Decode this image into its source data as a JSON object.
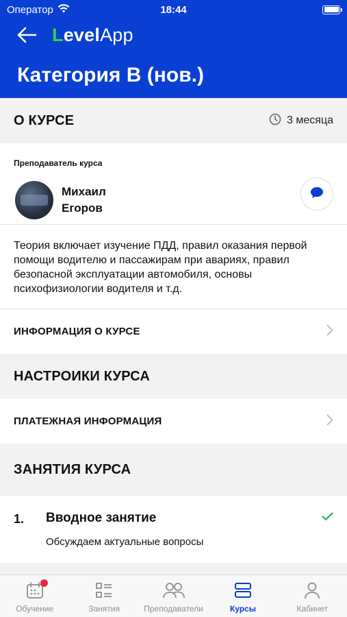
{
  "status": {
    "carrier": "Оператор",
    "time": "18:44"
  },
  "header": {
    "logo_l": "L",
    "logo_evel": "evel",
    "logo_app": "App",
    "title": "Категория В (нов.)"
  },
  "about": {
    "heading": "О КУРСЕ",
    "duration": "3 месяца",
    "teacher_label": "Преподаватель курса",
    "teacher_first": "Михаил",
    "teacher_last": "Егоров",
    "description": "Теория включает изучение ПДД, правил оказания первой помощи водителю и пассажирам при авариях, правил безопасной эксплуатации автомобиля, основы психофизиологии водителя и т.д.",
    "info_link": "ИНФОРМАЦИЯ О КУРСЕ"
  },
  "settings": {
    "heading": "НАСТРОИКИ КУРСА",
    "payment_link": "ПЛАТЕЖНАЯ ИНФОРМАЦИЯ"
  },
  "lessons": {
    "heading": "ЗАНЯТИЯ КУРСА",
    "items": [
      {
        "num": "1.",
        "name": "Вводное занятие",
        "sub": "Обсуждаем актуальные вопросы",
        "done": true
      }
    ]
  },
  "tabs": [
    {
      "label": "Обучение",
      "icon": "calendar-icon"
    },
    {
      "label": "Занятия",
      "icon": "list-icon"
    },
    {
      "label": "Преподаватели",
      "icon": "people-icon"
    },
    {
      "label": "Курсы",
      "icon": "courses-icon",
      "active": true
    },
    {
      "label": "Кабинет",
      "icon": "person-icon"
    }
  ],
  "colors": {
    "brand": "#0a3fd4",
    "logo_green": "#35d04a",
    "check": "#2bb24c",
    "badge": "#e8293b"
  }
}
